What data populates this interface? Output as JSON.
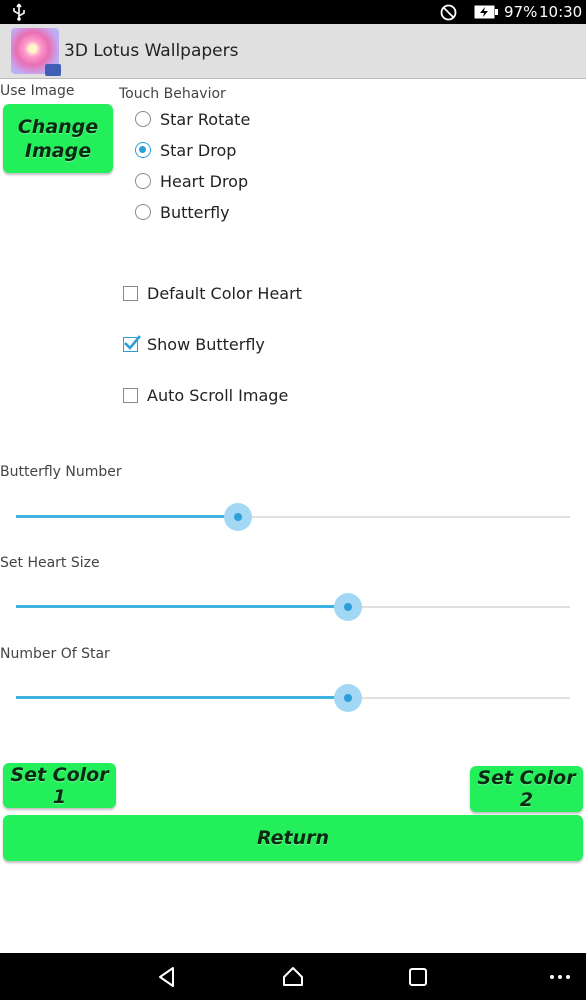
{
  "status_bar": {
    "battery": "97%",
    "time": "10:30"
  },
  "app_bar": {
    "title": "3D Lotus Wallpapers"
  },
  "use_image": {
    "label": "Use Image",
    "button": "Change Image"
  },
  "touch_behavior": {
    "label": "Touch Behavior",
    "options": [
      {
        "label": "Star Rotate",
        "selected": false
      },
      {
        "label": "Star Drop",
        "selected": true
      },
      {
        "label": "Heart Drop",
        "selected": false
      },
      {
        "label": "Butterfly",
        "selected": false
      }
    ]
  },
  "checkboxes": [
    {
      "label": "Default Color Heart",
      "checked": false
    },
    {
      "label": "Show Butterfly",
      "checked": true
    },
    {
      "label": "Auto Scroll Image",
      "checked": false
    }
  ],
  "sliders": [
    {
      "label": "Butterfly Number",
      "value_fraction": 0.4
    },
    {
      "label": "Set Heart Size",
      "value_fraction": 0.6
    },
    {
      "label": "Number Of Star",
      "value_fraction": 0.6
    }
  ],
  "buttons": {
    "set_color_1": "Set Color 1",
    "set_color_2": "Set Color 2",
    "return": "Return"
  },
  "colors": {
    "button_green": "#22ef5a",
    "accent_blue": "#2c9ed8",
    "app_bar": "#e0e0e0"
  },
  "icons": {
    "status": [
      "usb-icon",
      "do-not-disturb-icon",
      "battery-charging-icon"
    ],
    "nav": [
      "back-icon",
      "home-icon",
      "recents-icon",
      "more-icon"
    ]
  }
}
